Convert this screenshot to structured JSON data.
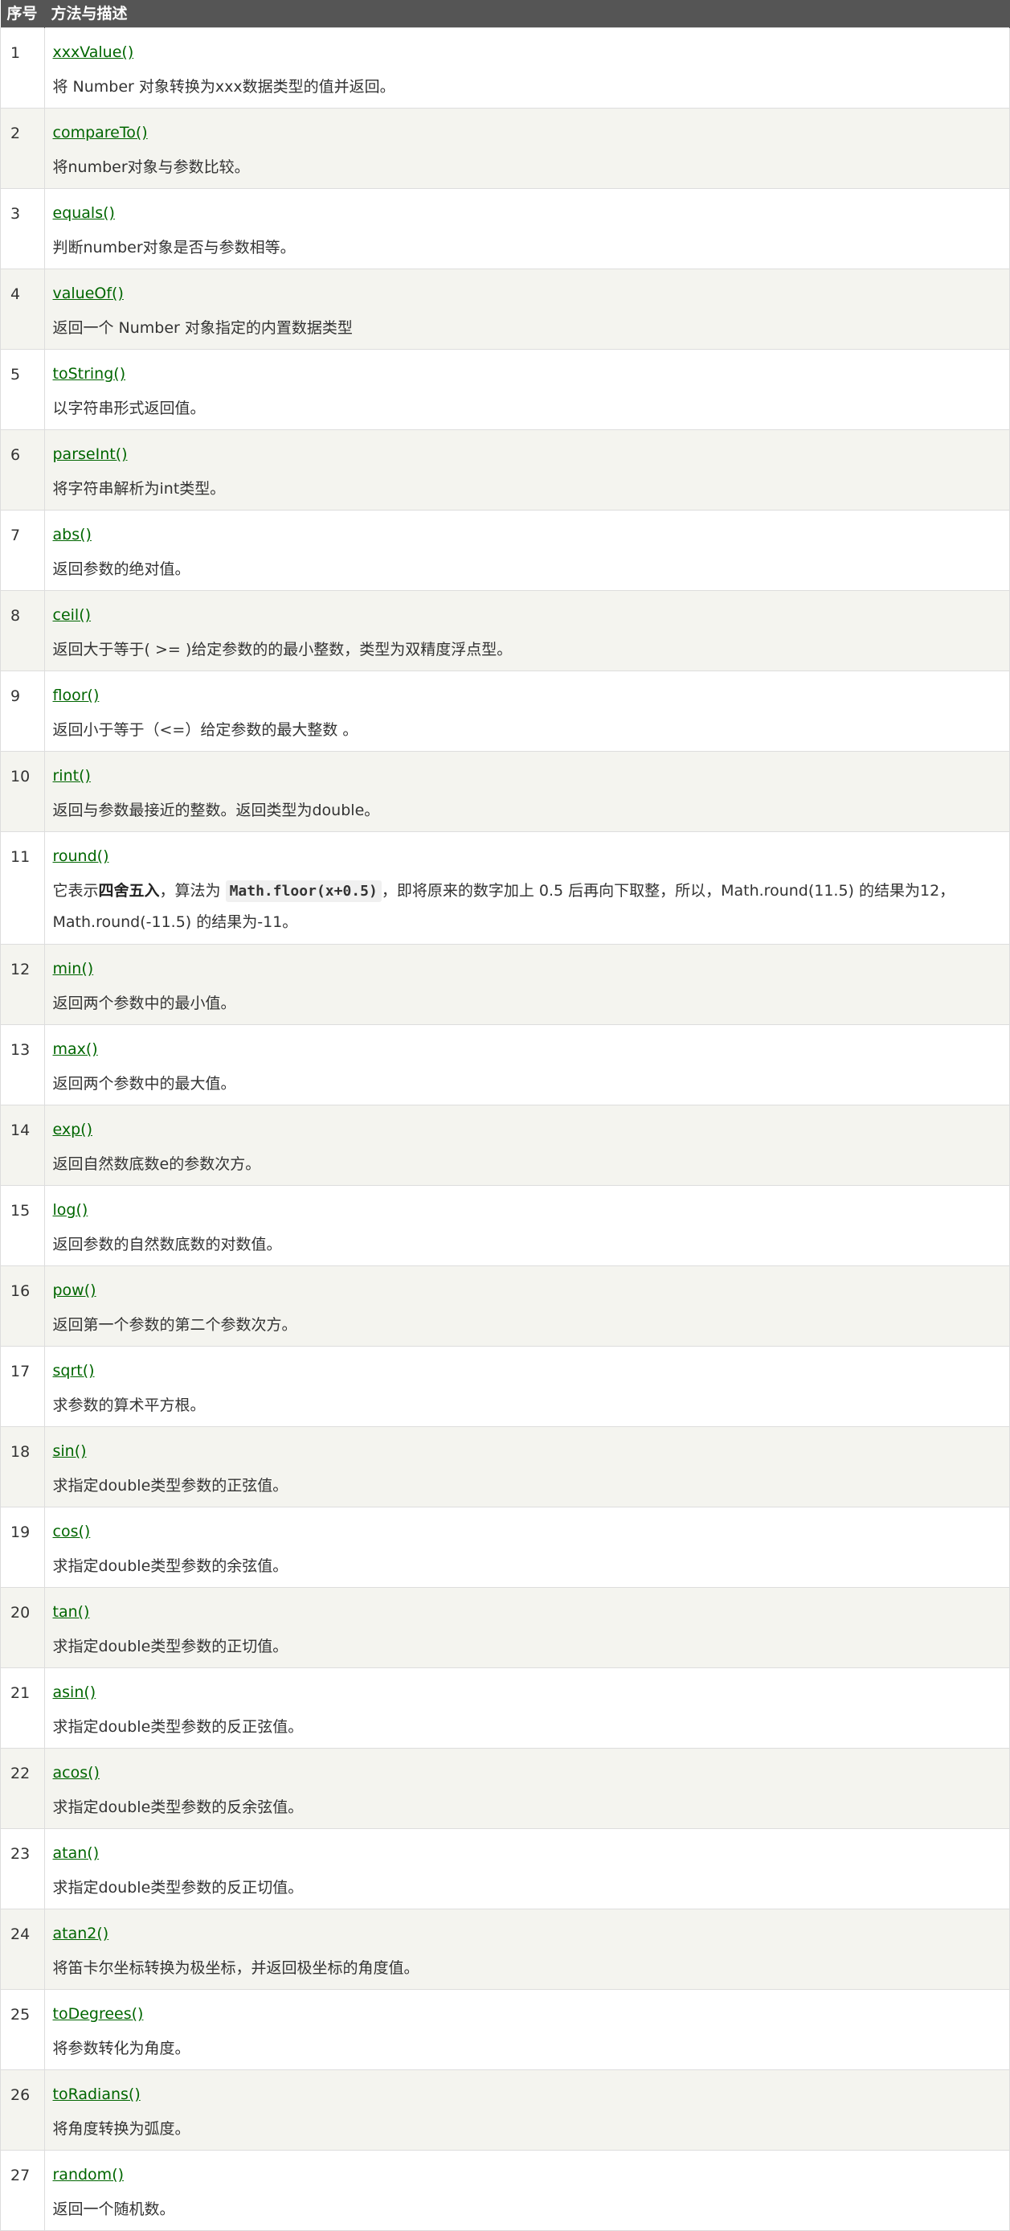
{
  "header": {
    "col_num": "序号",
    "col_desc": "方法与描述"
  },
  "rows": [
    {
      "num": "1",
      "method": "xxxValue()",
      "desc": "将 Number 对象转换为xxx数据类型的值并返回。"
    },
    {
      "num": "2",
      "method": "compareTo()",
      "desc": "将number对象与参数比较。"
    },
    {
      "num": "3",
      "method": "equals()",
      "desc": "判断number对象是否与参数相等。"
    },
    {
      "num": "4",
      "method": "valueOf()",
      "desc": "返回一个 Number 对象指定的内置数据类型"
    },
    {
      "num": "5",
      "method": "toString()",
      "desc": "以字符串形式返回值。"
    },
    {
      "num": "6",
      "method": "parseInt()",
      "desc": "将字符串解析为int类型。"
    },
    {
      "num": "7",
      "method": "abs()",
      "desc": "返回参数的绝对值。"
    },
    {
      "num": "8",
      "method": "ceil()",
      "desc": "返回大于等于( >= )给定参数的的最小整数，类型为双精度浮点型。"
    },
    {
      "num": "9",
      "method": "floor()",
      "desc": "返回小于等于（<=）给定参数的最大整数 。"
    },
    {
      "num": "10",
      "method": "rint()",
      "desc": "返回与参数最接近的整数。返回类型为double。"
    },
    {
      "num": "11",
      "method": "round()",
      "desc_parts": {
        "p1": "它表示",
        "bold": "四舍五入",
        "p2": "，算法为 ",
        "code": "Math.floor(x+0.5)",
        "p3": "，即将原来的数字加上 0.5 后再向下取整，所以，Math.round(11.5) 的结果为12，",
        "line2": "Math.round(-11.5) 的结果为-11。"
      }
    },
    {
      "num": "12",
      "method": "min()",
      "desc": "返回两个参数中的最小值。"
    },
    {
      "num": "13",
      "method": "max()",
      "desc": "返回两个参数中的最大值。"
    },
    {
      "num": "14",
      "method": "exp()",
      "desc": "返回自然数底数e的参数次方。"
    },
    {
      "num": "15",
      "method": "log()",
      "desc": "返回参数的自然数底数的对数值。"
    },
    {
      "num": "16",
      "method": "pow()",
      "desc": "返回第一个参数的第二个参数次方。"
    },
    {
      "num": "17",
      "method": "sqrt()",
      "desc": "求参数的算术平方根。"
    },
    {
      "num": "18",
      "method": "sin()",
      "desc": "求指定double类型参数的正弦值。"
    },
    {
      "num": "19",
      "method": "cos()",
      "desc": "求指定double类型参数的余弦值。"
    },
    {
      "num": "20",
      "method": "tan()",
      "desc": "求指定double类型参数的正切值。"
    },
    {
      "num": "21",
      "method": "asin()",
      "desc": "求指定double类型参数的反正弦值。"
    },
    {
      "num": "22",
      "method": "acos()",
      "desc": "求指定double类型参数的反余弦值。"
    },
    {
      "num": "23",
      "method": "atan()",
      "desc": "求指定double类型参数的反正切值。"
    },
    {
      "num": "24",
      "method": "atan2()",
      "desc": "将笛卡尔坐标转换为极坐标，并返回极坐标的角度值。"
    },
    {
      "num": "25",
      "method": "toDegrees()",
      "desc": "将参数转化为角度。"
    },
    {
      "num": "26",
      "method": "toRadians()",
      "desc": "将角度转换为弧度。"
    },
    {
      "num": "27",
      "method": "random()",
      "desc": "返回一个随机数。"
    }
  ]
}
